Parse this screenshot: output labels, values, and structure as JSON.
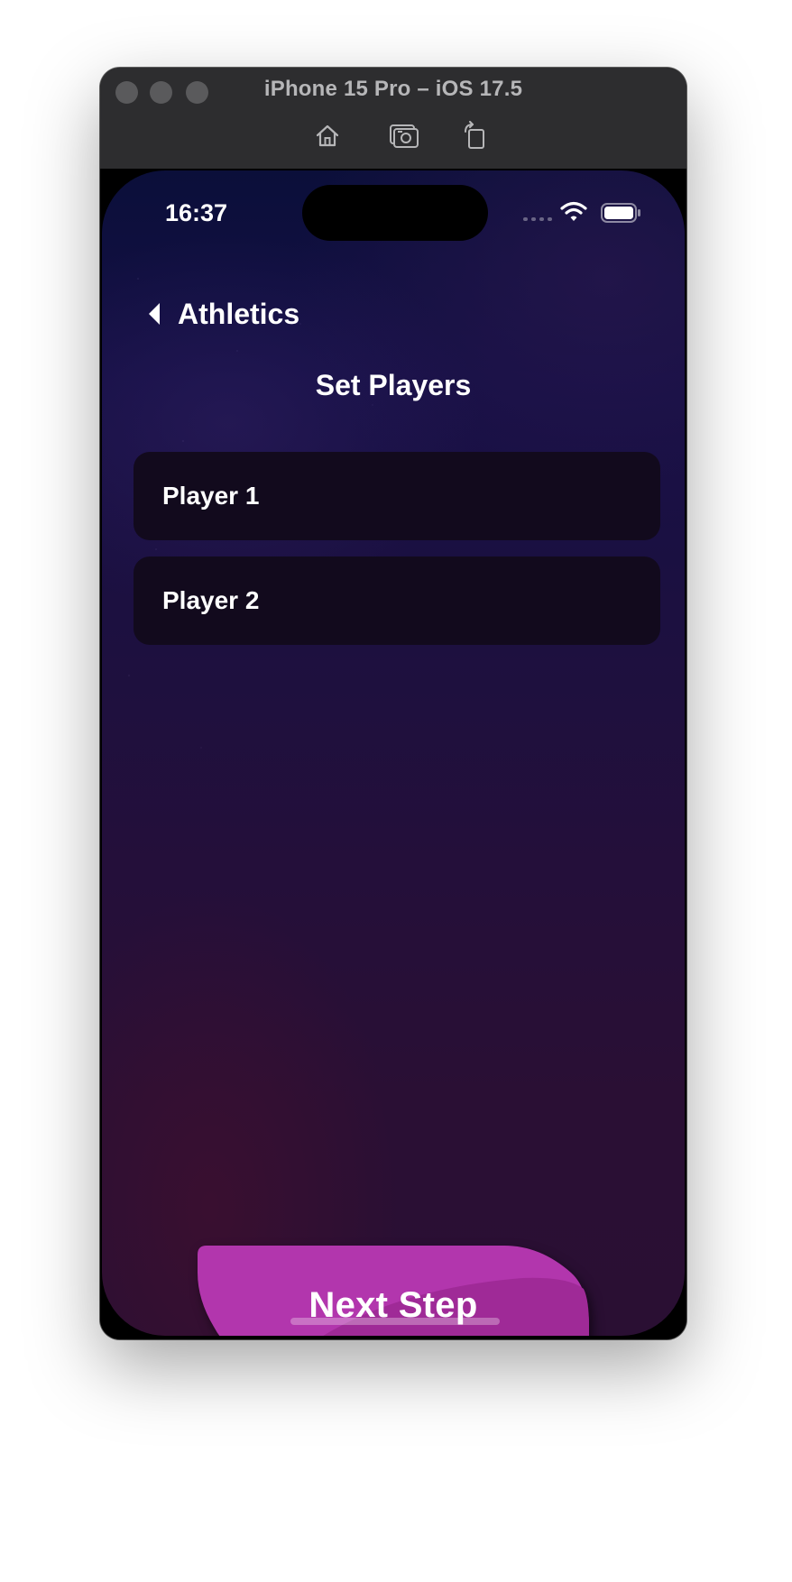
{
  "simulator": {
    "title": "iPhone 15 Pro – iOS 17.5",
    "toolbar": {
      "home_icon": "home-icon",
      "screenshot_icon": "camera-icon",
      "rotate_icon": "rotate-icon"
    }
  },
  "status_bar": {
    "time": "16:37",
    "wifi_icon": "wifi-icon",
    "battery_icon": "battery-icon"
  },
  "nav": {
    "back_label": "Athletics",
    "back_icon": "chevron-left-icon"
  },
  "screen": {
    "title": "Set Players"
  },
  "players": [
    {
      "label": "Player 1"
    },
    {
      "label": "Player 2"
    }
  ],
  "actions": {
    "next_label": "Next Step"
  },
  "colors": {
    "button_primary": "#b236ad",
    "button_secondary": "#9f2a97",
    "row_background": "#120a1d",
    "background_top": "#0b0f3a",
    "background_bottom": "#2a0f33"
  }
}
